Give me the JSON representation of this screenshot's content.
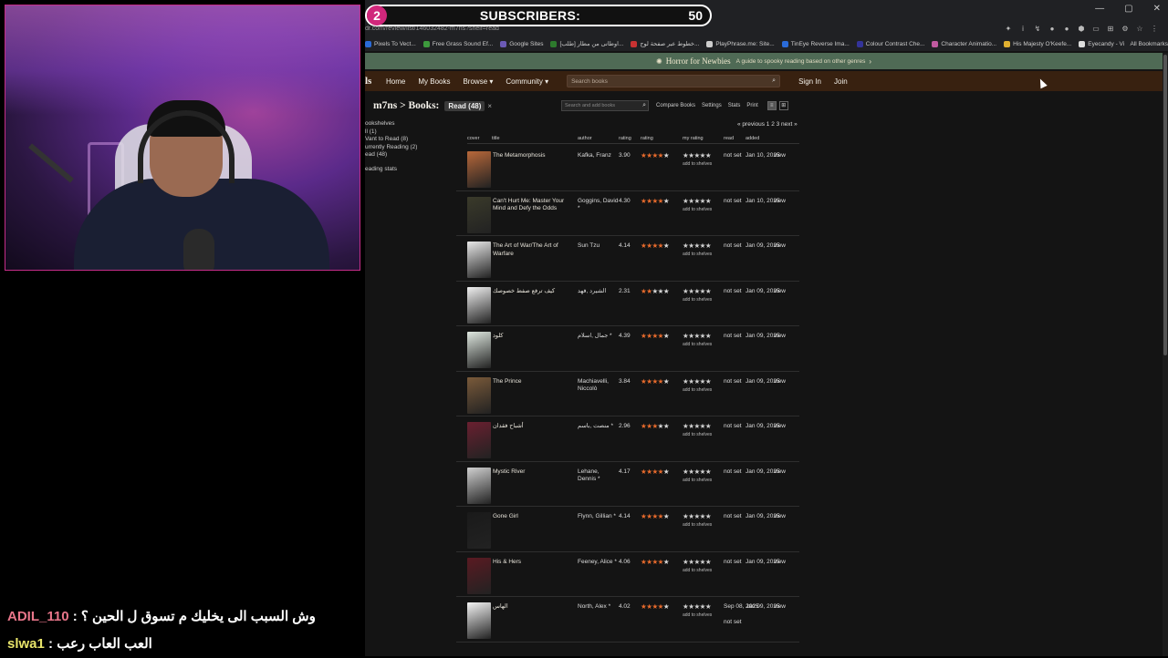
{
  "overlay": {
    "sub_count_index": "2",
    "subscribers_label": "SUBSCRIBERS:",
    "subscribers_goal": "50"
  },
  "chat": [
    {
      "user": "ADIL_110",
      "sep": " : ",
      "message": "وش السبب الى يخليك م تسوق ل الحين ؟"
    },
    {
      "user": "slwa1",
      "sep": " : ",
      "message": "العب العاب رعب"
    }
  ],
  "browser": {
    "url": "dr.com/review/list/146032482-m7ns?shelf=read",
    "window_controls": [
      "—",
      "▢",
      "✕"
    ],
    "extensions": [
      "✦",
      "i",
      "↯",
      "●",
      "●",
      "⬢",
      "▭",
      "⊞",
      "⚙",
      "☆",
      "⋮"
    ],
    "bookmarks": [
      {
        "label": "Pixels To Vect...",
        "color": "#2a6bd8"
      },
      {
        "label": "Free Grass Sound Ef...",
        "color": "#3d9a3d"
      },
      {
        "label": "Google Sites",
        "color": "#6b5ab5"
      },
      {
        "label": "[طلب] اوطانی من مطار...",
        "color": "#2d7a2d"
      },
      {
        "label": "خطوط عبر صفحة لوج...",
        "color": "#c83232"
      },
      {
        "label": "PlayPhrase.me: Site...",
        "color": "#cccccc"
      },
      {
        "label": "TinEye Reverse Ima...",
        "color": "#2a6bd8"
      },
      {
        "label": "Colour Contrast Che...",
        "color": "#333399"
      },
      {
        "label": "Character Animatio...",
        "color": "#c05aa0"
      },
      {
        "label": "His Majesty O'Keefe...",
        "color": "#e0b030"
      },
      {
        "label": "Eyecandy - Visual Te...",
        "color": "#dddddd"
      }
    ],
    "all_bookmarks": "All Bookmarks"
  },
  "banner": {
    "title": "Horror for Newbies",
    "subtitle": "A guide to spooky reading based on other genres"
  },
  "nav": {
    "logo": "ls",
    "items": [
      "Home",
      "My Books",
      "Browse ▾",
      "Community ▾"
    ],
    "search_placeholder": "Search books",
    "sign_in": "Sign In",
    "join": "Join"
  },
  "shelf": {
    "title": "m7ns > Books:",
    "filter": "Read (48)",
    "remove": "×",
    "search_placeholder": "Search and add books",
    "links": [
      "Compare Books",
      "Settings",
      "Stats",
      "Print"
    ]
  },
  "sidebar": {
    "heading": "ookshelves",
    "items": [
      "ll (1)",
      "Vant to Read (8)",
      "urrently Reading (2)",
      "ead (48)"
    ],
    "stats": "eading stats"
  },
  "pager": "« previous 1 2 3 next »",
  "columns": [
    "cover",
    "title",
    "author",
    "rating",
    "rating",
    "my rating",
    "read",
    "added"
  ],
  "books": [
    {
      "title": "The Metamorphosis",
      "author": "Kafka, Franz",
      "avg": "3.90",
      "rating_stars": 4,
      "read": "not set",
      "added": "Jan 10, 2025",
      "cover": "#b8683a"
    },
    {
      "title": "Can't Hurt Me: Master Your Mind and Defy the Odds",
      "author": "Goggins, David *",
      "avg": "4.30",
      "rating_stars": 4,
      "read": "not set",
      "added": "Jan 10, 2025",
      "cover": "#3a3a2a"
    },
    {
      "title": "The Art of War/The Art of Warfare",
      "author": "Sun Tzu",
      "avg": "4.14",
      "rating_stars": 4,
      "read": "not set",
      "added": "Jan 09, 2025",
      "cover": "#e8e8e8"
    },
    {
      "title": "كيف ترفع صفط خصوصك",
      "author": "الشيرد ,فهد",
      "avg": "2.31",
      "rating_stars": 2,
      "read": "not set",
      "added": "Jan 09, 2025",
      "cover": "#f0f0f0"
    },
    {
      "title": "كلود",
      "author": "جمال ,اسلام *",
      "avg": "4.39",
      "rating_stars": 4,
      "read": "not set",
      "added": "Jan 09, 2025",
      "cover": "#dfe8e0"
    },
    {
      "title": "The Prince",
      "author": "Machiavelli, Niccolò",
      "avg": "3.84",
      "rating_stars": 4,
      "read": "not set",
      "added": "Jan 09, 2025",
      "cover": "#7a5a3a"
    },
    {
      "title": "أشباح فقدان",
      "author": "منصت ,باسم *",
      "avg": "2.96",
      "rating_stars": 3,
      "read": "not set",
      "added": "Jan 09, 2025",
      "cover": "#6a2030"
    },
    {
      "title": "Mystic River",
      "author": "Lehane, Dennis *",
      "avg": "4.17",
      "rating_stars": 4,
      "read": "not set",
      "added": "Jan 09, 2025",
      "cover": "#d0d0d0"
    },
    {
      "title": "Gone Girl",
      "author": "Flynn, Gillian *",
      "avg": "4.14",
      "rating_stars": 4,
      "read": "not set",
      "added": "Jan 09, 2025",
      "cover": "#1a1a1a"
    },
    {
      "title": "His & Hers",
      "author": "Feeney, Alice *",
      "avg": "4.06",
      "rating_stars": 4,
      "read": "not set",
      "added": "Jan 09, 2025",
      "cover": "#5a1a22"
    },
    {
      "title": "الهاس",
      "author": "North, Alex *",
      "avg": "4.02",
      "rating_stars": 4,
      "read": "Sep 08, 2025",
      "read2": "not set",
      "added": "Jan 09, 2025",
      "cover": "#f4f4f4"
    }
  ],
  "add_to_shelves": "add to shelves",
  "view_label": "view"
}
